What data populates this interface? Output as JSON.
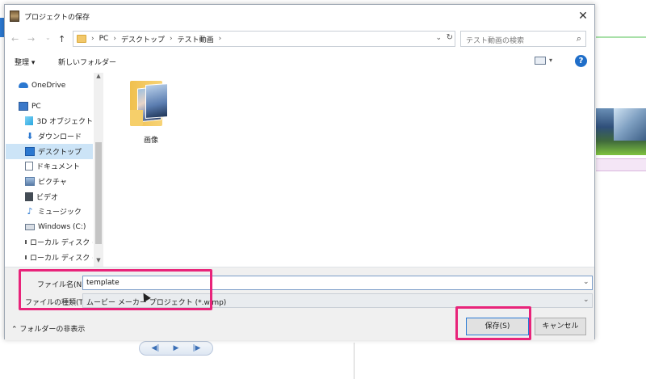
{
  "dialog": {
    "title": "プロジェクトの保存",
    "close_glyph": "✕"
  },
  "nav": {
    "back_glyph": "←",
    "forward_glyph": "→",
    "recent_glyph": "⌄",
    "up_glyph": "↑",
    "breadcrumb": [
      "PC",
      "デスクトップ",
      "テスト動画"
    ],
    "crumb_sep": "›",
    "search_placeholder": "テスト動画の検索"
  },
  "toolbar": {
    "organize": "整理 ▾",
    "new_folder": "新しいフォルダー",
    "help": "?"
  },
  "sidebar": {
    "items": [
      {
        "label": "OneDrive",
        "icon": "cloud-icon",
        "color": "#2b78d0"
      },
      {
        "label": "PC",
        "icon": "computer-icon",
        "color": "#3a78c9"
      },
      {
        "label": "3D オブジェクト",
        "icon": "cube-icon",
        "color": "#2aa8e0"
      },
      {
        "label": "ダウンロード",
        "icon": "download-icon",
        "color": "#2b78d0"
      },
      {
        "label": "デスクトップ",
        "icon": "desktop-icon",
        "color": "#2b78d0",
        "selected": true
      },
      {
        "label": "ドキュメント",
        "icon": "document-icon",
        "color": "#6b7b8f"
      },
      {
        "label": "ピクチャ",
        "icon": "picture-icon",
        "color": "#5a7ca6"
      },
      {
        "label": "ビデオ",
        "icon": "video-icon",
        "color": "#444c55"
      },
      {
        "label": "ミュージック",
        "icon": "music-icon",
        "color": "#2b78d0"
      },
      {
        "label": "Windows (C:)",
        "icon": "drive-icon",
        "color": "#6b7b8f"
      },
      {
        "label": "ローカル ディスク (D",
        "icon": "drive-icon",
        "color": "#555"
      },
      {
        "label": "ローカル ディスク (E",
        "icon": "drive-icon",
        "color": "#555"
      }
    ]
  },
  "content": {
    "folders": [
      {
        "label": "画像"
      }
    ]
  },
  "form": {
    "filename_label": "ファイル名(N):",
    "filename_value": "template",
    "filetype_label": "ファイルの種類(T):",
    "filetype_value": "ムービー メーカー プロジェクト (*.wlmp)"
  },
  "footer": {
    "hide_folders": "フォルダーの非表示",
    "save": "保存(S)",
    "cancel": "キャンセル"
  },
  "colors": {
    "highlight": "#e8247a",
    "accent": "#1f6ec9"
  }
}
